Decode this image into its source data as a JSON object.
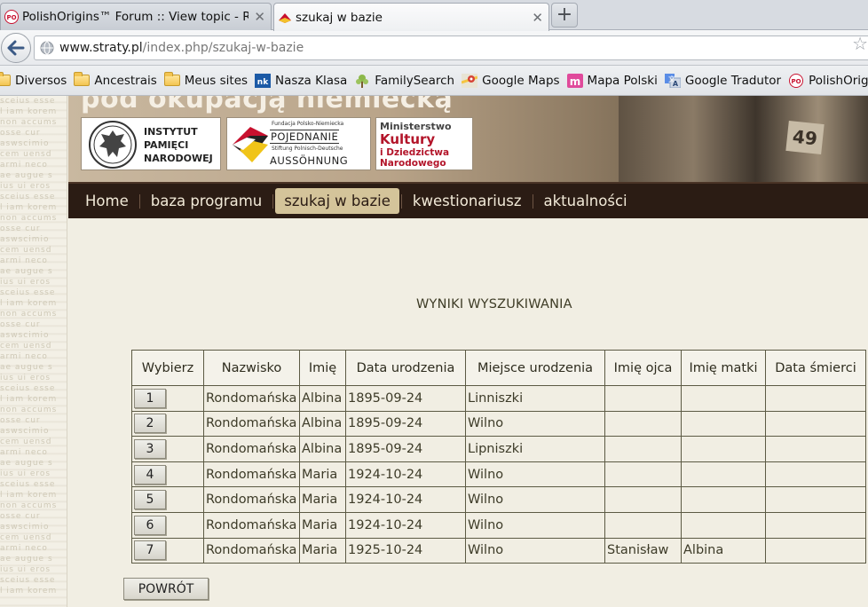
{
  "browser": {
    "tabs": [
      {
        "title": "PolishOrigins™ Forum :: View topic - Ron...",
        "favicon": "po-icon",
        "active": false
      },
      {
        "title": "szukaj w bazie",
        "favicon": "straty-icon",
        "active": true
      }
    ],
    "url_domain": "www.straty.pl",
    "url_path": "/index.php/szukaj-w-bazie",
    "bookmarks": [
      {
        "label": "Diversos",
        "icon": "folder-icon"
      },
      {
        "label": "Ancestrais",
        "icon": "folder-icon"
      },
      {
        "label": "Meus sites",
        "icon": "folder-icon"
      },
      {
        "label": "Nasza Klasa",
        "icon": "nk-icon"
      },
      {
        "label": "FamilySearch",
        "icon": "familysearch-icon"
      },
      {
        "label": "Google Maps",
        "icon": "maps-icon"
      },
      {
        "label": "Mapa Polski",
        "icon": "mapa-icon"
      },
      {
        "label": "Google Tradutor",
        "icon": "translate-icon"
      },
      {
        "label": "PolishOrigins",
        "icon": "po-icon"
      }
    ]
  },
  "banner": {
    "heading": "pod okupacją niemiecką",
    "ipn": {
      "line1": "INSTYTUT",
      "line2": "PAMIĘCI",
      "line3": "NARODOWEJ"
    },
    "fundacja": {
      "small1": "Fundacja Polsko-Niemiecka",
      "big1": "POJEDNANIE",
      "small2": "Stiftung Polnisch-Deutsche",
      "big2": "AUSSÖHNUNG"
    },
    "ministerstwo": {
      "line1": "Ministerstwo",
      "line2": "Kultury",
      "line3": "i Dziedzictwa",
      "line4": "Narodowego"
    },
    "photo_tag": "49"
  },
  "menu": {
    "items": [
      "Home",
      "baza programu",
      "szukaj w bazie",
      "kwestionariusz",
      "aktualności"
    ],
    "active_index": 2
  },
  "results": {
    "title": "WYNIKI WYSZUKIWANIA",
    "headers": [
      "Wybierz",
      "Nazwisko",
      "Imię",
      "Data urodzenia",
      "Miejsce urodzenia",
      "Imię ojca",
      "Imię matki",
      "Data śmierci"
    ],
    "rows": [
      {
        "button": "1",
        "nazwisko": "Rondomańska",
        "imie": "Albina",
        "data": "1895-09-24",
        "miejsce": "Linniszki",
        "ojciec": "",
        "matka": "",
        "smierc": ""
      },
      {
        "button": "2",
        "nazwisko": "Rondomańska",
        "imie": "Albina",
        "data": "1895-09-24",
        "miejsce": "Wilno",
        "ojciec": "",
        "matka": "",
        "smierc": ""
      },
      {
        "button": "3",
        "nazwisko": "Rondomańska",
        "imie": "Albina",
        "data": "1895-09-24",
        "miejsce": "Lipniszki",
        "ojciec": "",
        "matka": "",
        "smierc": ""
      },
      {
        "button": "4",
        "nazwisko": "Rondomańska",
        "imie": "Maria",
        "data": "1924-10-24",
        "miejsce": "Wilno",
        "ojciec": "",
        "matka": "",
        "smierc": ""
      },
      {
        "button": "5",
        "nazwisko": "Rondomańska",
        "imie": "Maria",
        "data": "1924-10-24",
        "miejsce": "Wilno",
        "ojciec": "",
        "matka": "",
        "smierc": ""
      },
      {
        "button": "6",
        "nazwisko": "Rondomańska",
        "imie": "Maria",
        "data": "1924-10-24",
        "miejsce": "Wilno",
        "ojciec": "",
        "matka": "",
        "smierc": ""
      },
      {
        "button": "7",
        "nazwisko": "Rondomańska",
        "imie": "Maria",
        "data": "1925-10-24",
        "miejsce": "Wilno",
        "ojciec": "Stanisław",
        "matka": "Albina",
        "smierc": ""
      }
    ],
    "back_button": "POWRÓT"
  },
  "colors": {
    "page_bg": "#f1eee3",
    "menubar_bg": "#2b1c14",
    "menu_active_bg": "#d4c49a",
    "table_text": "#3d3b28"
  }
}
